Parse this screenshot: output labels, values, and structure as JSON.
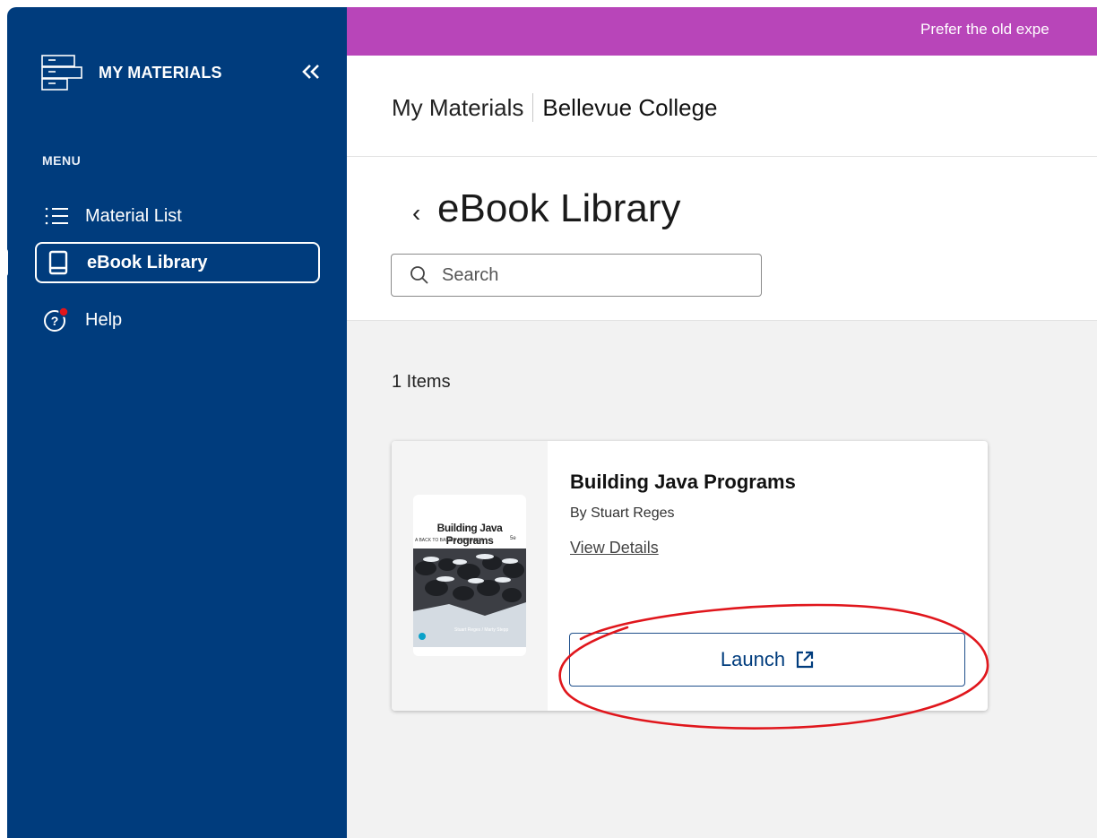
{
  "sidebar": {
    "brand": "MY MATERIALS",
    "menu_heading": "MENU",
    "items": [
      {
        "label": "Material List",
        "icon": "list-icon"
      },
      {
        "label": "eBook Library",
        "icon": "book-icon",
        "active": true
      },
      {
        "label": "Help",
        "icon": "help-icon"
      }
    ]
  },
  "banner": {
    "text": "Prefer the old expe"
  },
  "header": {
    "section": "My Materials",
    "school": "Bellevue College"
  },
  "page": {
    "title": "eBook Library",
    "back_glyph": "‹"
  },
  "search": {
    "placeholder": "Search",
    "value": ""
  },
  "library": {
    "count_text": "1 Items",
    "books": [
      {
        "title": "Building Java Programs",
        "author": "By Stuart Reges",
        "details_link": "View Details",
        "launch_label": "Launch",
        "cover": {
          "title": "Building Java Programs",
          "subtitle": "A BACK TO BASICS APPROACH",
          "edition": "5e",
          "authors": "Stuart Reges / Marty Stepp"
        }
      }
    ]
  },
  "colors": {
    "sidebar": "#003c7d",
    "banner": "#b845b9",
    "content_bg": "#f2f2f2",
    "annotation": "#e0161c"
  }
}
